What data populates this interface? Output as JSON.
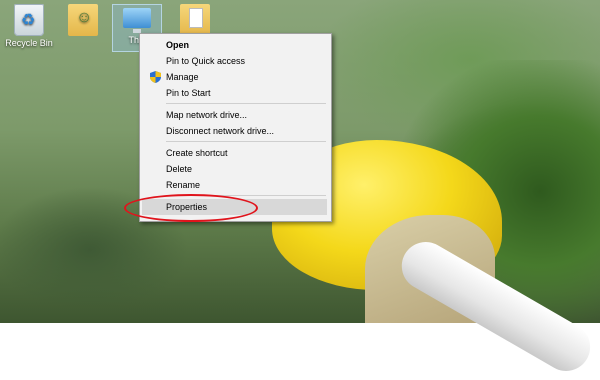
{
  "desktop": {
    "icons": [
      {
        "label": "Recycle Bin",
        "icon": "recycle-bin-icon"
      },
      {
        "label": "",
        "icon": "user-folder-icon"
      },
      {
        "label": "This",
        "icon": "computer-icon",
        "selected": true
      },
      {
        "label": "",
        "icon": "document-folder-icon"
      }
    ]
  },
  "context_menu": {
    "items": [
      {
        "label": "Open",
        "bold": true
      },
      {
        "label": "Pin to Quick access"
      },
      {
        "label": "Manage",
        "icon": "shield-icon"
      },
      {
        "label": "Pin to Start"
      },
      {
        "label": "Map network drive..."
      },
      {
        "label": "Disconnect network drive..."
      },
      {
        "label": "Create shortcut"
      },
      {
        "label": "Delete"
      },
      {
        "label": "Rename"
      },
      {
        "label": "Properties",
        "highlighted": true
      }
    ]
  },
  "colors": {
    "annotation": "#e0141c",
    "menu_background": "#f2f2f2",
    "highlight": "#d8d8d8"
  }
}
